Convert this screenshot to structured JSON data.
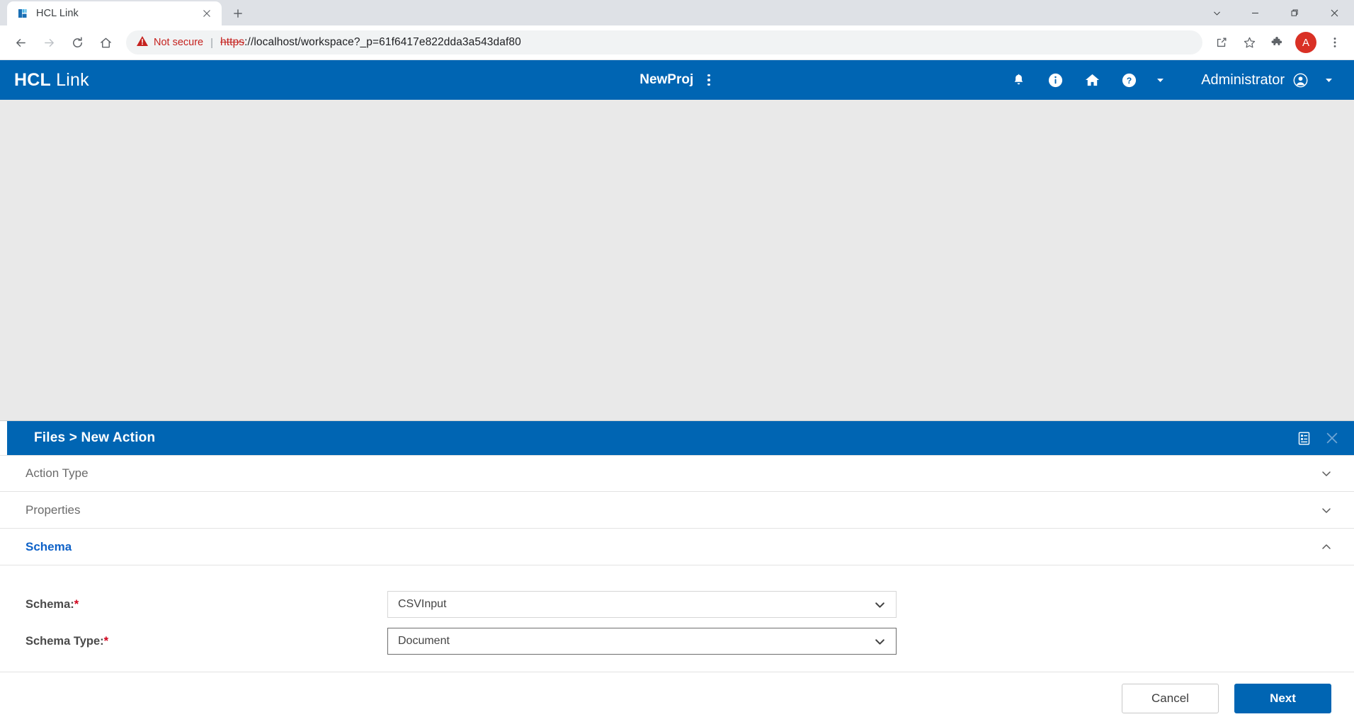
{
  "browser": {
    "tab": {
      "title": "HCL Link",
      "favicon_icon": "hcl-link-favicon",
      "close_icon": "close-icon"
    },
    "new_tab_icon": "plus-icon",
    "window_controls": {
      "tab_search_icon": "chevron-down-icon",
      "minimize_icon": "minimize-icon",
      "maximize_icon": "maximize-icon",
      "close_icon": "close-icon"
    },
    "nav": {
      "back_icon": "arrow-back-icon",
      "forward_icon": "arrow-forward-icon",
      "reload_icon": "reload-icon",
      "home_icon": "home-icon"
    },
    "omnibox": {
      "warning_icon": "warning-triangle-icon",
      "security_text": "Not secure",
      "separator": "|",
      "url_scheme": "https",
      "url_rest": "://localhost/workspace?_p=61f6417e822dda3a543daf80",
      "full_url": "https://localhost/workspace?_p=61f6417e822dda3a543daf80"
    },
    "toolbar_right": {
      "share_icon": "share-icon",
      "bookmark_icon": "star-icon",
      "extensions_icon": "puzzle-icon",
      "profile_initial": "A",
      "menu_icon": "three-dot-menu-icon"
    }
  },
  "app_header": {
    "brand_bold": "HCL",
    "brand_light": "Link",
    "project_name": "NewProj",
    "project_menu_icon": "three-dot-vertical-icon",
    "icons": {
      "notifications": "bell-icon",
      "info": "info-icon",
      "home": "home-icon",
      "help": "help-question-icon",
      "help_caret": "chevron-down-icon"
    },
    "user_name": "Administrator",
    "user_avatar_icon": "account-circle-icon",
    "user_caret": "chevron-down-icon"
  },
  "dialog": {
    "title": "Files > New Action",
    "notes_icon": "notes-list-icon",
    "close_icon": "close-icon",
    "sections": [
      {
        "label": "Action Type",
        "expanded": false,
        "chevron_icon": "chevron-down-icon"
      },
      {
        "label": "Properties",
        "expanded": false,
        "chevron_icon": "chevron-down-icon"
      },
      {
        "label": "Schema",
        "expanded": true,
        "chevron_icon": "chevron-up-icon"
      }
    ],
    "fields": [
      {
        "label": "Schema:",
        "required_marker": "*",
        "value": "CSVInput",
        "caret_icon": "chevron-down-icon",
        "focused": false
      },
      {
        "label": "Schema Type:",
        "required_marker": "*",
        "value": "Document",
        "caret_icon": "chevron-down-icon",
        "focused": true
      }
    ],
    "footer": {
      "cancel_label": "Cancel",
      "next_label": "Next"
    }
  },
  "colors": {
    "brand_blue": "#0065b3",
    "active_section_blue": "#0f62c8",
    "required_red": "#d0021b",
    "not_secure_red": "#c5221f",
    "app_body_gray": "#e9e9e9"
  }
}
